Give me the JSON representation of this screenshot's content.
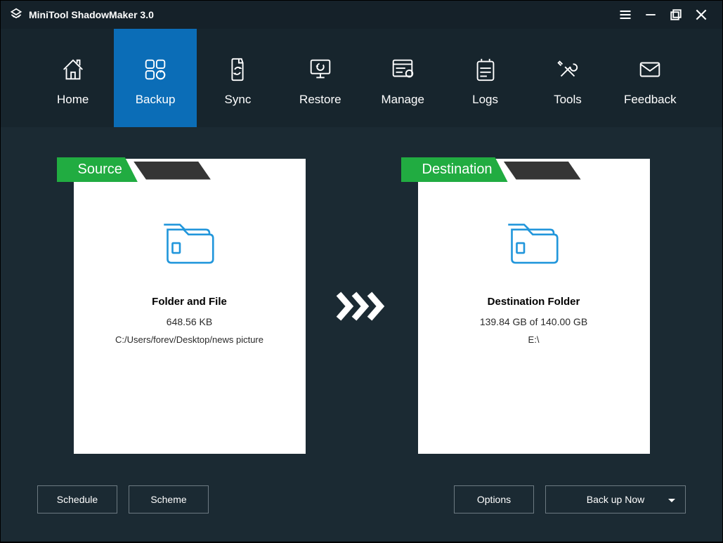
{
  "titlebar": {
    "title": "MiniTool ShadowMaker 3.0"
  },
  "nav": {
    "items": [
      {
        "label": "Home"
      },
      {
        "label": "Backup"
      },
      {
        "label": "Sync"
      },
      {
        "label": "Restore"
      },
      {
        "label": "Manage"
      },
      {
        "label": "Logs"
      },
      {
        "label": "Tools"
      },
      {
        "label": "Feedback"
      }
    ],
    "active_index": 1
  },
  "source": {
    "header": "Source",
    "title": "Folder and File",
    "size": "648.56 KB",
    "path": "C:/Users/forev/Desktop/news picture"
  },
  "destination": {
    "header": "Destination",
    "title": "Destination Folder",
    "size": "139.84 GB of 140.00 GB",
    "path": "E:\\"
  },
  "footer": {
    "schedule": "Schedule",
    "scheme": "Scheme",
    "options": "Options",
    "backup_now": "Back up Now"
  },
  "colors": {
    "accent": "#0b6db7",
    "green": "#21ac41",
    "folder": "#2196db"
  }
}
